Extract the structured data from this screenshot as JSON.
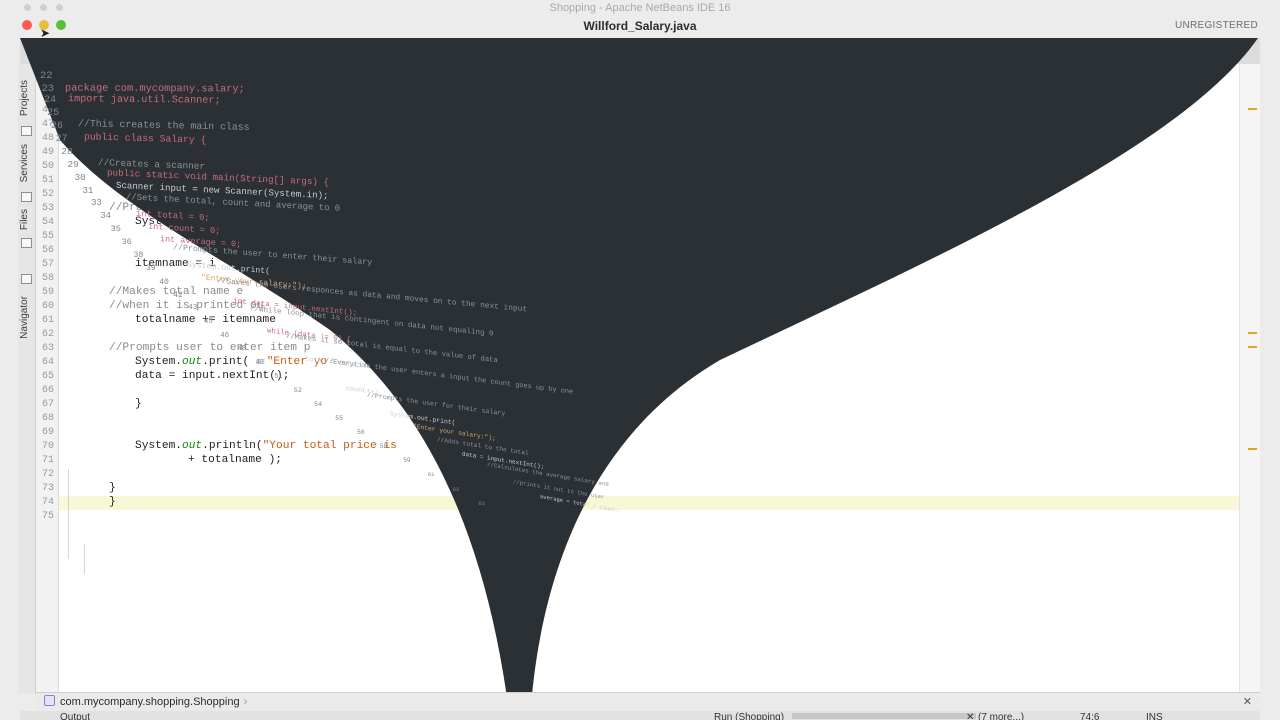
{
  "window": {
    "app_title": "Shopping - Apache NetBeans IDE 16",
    "file_title": "Willford_Salary.java",
    "registration": "UNREGISTERED"
  },
  "tabs": [
    {
      "label": "Willford_Salary.java",
      "active": true
    }
  ],
  "sidebar": {
    "items": [
      "Projects",
      "Services",
      "Files",
      "Navigator"
    ]
  },
  "editor": {
    "lines": [
      {
        "num": "44"
      },
      {
        "num": "45"
      },
      {
        "num": "46"
      },
      {
        "num": "47"
      },
      {
        "num": "48"
      },
      {
        "num": "49"
      },
      {
        "num": "50"
      },
      {
        "num": "51"
      },
      {
        "num": "52"
      },
      {
        "num": "53",
        "comment": "//Promp"
      },
      {
        "num": "54",
        "code": "System"
      },
      {
        "num": "55"
      },
      {
        "num": "56"
      },
      {
        "num": "57",
        "code": "itemname = i"
      },
      {
        "num": "58"
      },
      {
        "num": "59",
        "comment": "//Makes total name e"
      },
      {
        "num": "60",
        "comment": "//when it is printed ou"
      },
      {
        "num": "61",
        "code": "totalname += itemname"
      },
      {
        "num": "62"
      },
      {
        "num": "63",
        "comment": "//Prompts user to enter item p"
      },
      {
        "num": "64",
        "pre": "System.",
        "field": "out",
        "mid": ".print( ",
        "hint": "s:",
        "string": "\"Enter yo"
      },
      {
        "num": "65",
        "code": "data = input.nextInt();"
      },
      {
        "num": "66"
      },
      {
        "num": "67",
        "code": "}"
      },
      {
        "num": "68"
      },
      {
        "num": "69"
      },
      {
        "num": "70",
        "pre": "System.",
        "field": "out",
        "mid": ".println(",
        "string": "\"Your total price is"
      },
      {
        "num": "71",
        "code": "+ totalname );"
      },
      {
        "num": "72"
      },
      {
        "num": "73",
        "code": "}"
      },
      {
        "num": "74",
        "code": "}",
        "highlight": true
      },
      {
        "num": "75"
      }
    ]
  },
  "ghost_code": {
    "lines": [
      {
        "num": "22",
        "text": ""
      },
      {
        "num": "23",
        "text": "package com.mycompany.salary;"
      },
      {
        "num": "24",
        "text": "import java.util.Scanner;"
      },
      {
        "num": "25",
        "text": ""
      },
      {
        "num": "26",
        "text": "//This creates the main class"
      },
      {
        "num": "27",
        "text": "public class Salary {"
      },
      {
        "num": "28",
        "text": ""
      },
      {
        "num": "29",
        "text": "//Creates a scanner"
      },
      {
        "num": "30",
        "text": "public static void main(String[] args) {"
      },
      {
        "num": "31",
        "text": "Scanner input = new Scanner(System.in);"
      },
      {
        "num": "33",
        "text": "//Sets the total, count and average to 0"
      },
      {
        "num": "34",
        "text": "int total = 0;"
      },
      {
        "num": "35",
        "text": "int count = 0;"
      },
      {
        "num": "36",
        "text": "int average = 0;"
      },
      {
        "num": "38",
        "text": "//Prompts the user to enter their salary"
      },
      {
        "num": "39",
        "text": "System.out.print("
      },
      {
        "num": "40",
        "text": "\"Enter your salary:\");"
      },
      {
        "num": "42",
        "text": "//Saves the users responces as data and moves on to the next input"
      },
      {
        "num": "43",
        "text": "int data = input.nextInt();"
      },
      {
        "num": "45",
        "text": "//While loop that is contingent on data not equaling 0"
      },
      {
        "num": "46",
        "text": "while (data != 0) {"
      },
      {
        "num": "48",
        "text": "//Makes it so total is equal to the value of data"
      },
      {
        "num": "49",
        "text": "total = data;"
      },
      {
        "num": "51",
        "text": "//Everytime the user enters a input the count goes up by one"
      },
      {
        "num": "52",
        "text": "count++;"
      },
      {
        "num": "54",
        "text": "//Prompts the user for their salary"
      },
      {
        "num": "55",
        "text": "System.out.print("
      },
      {
        "num": "56",
        "text": "\"Enter your salary:\");"
      },
      {
        "num": "58",
        "text": "//Adds total to the total"
      },
      {
        "num": "59",
        "text": "data = input.nextInt();"
      },
      {
        "num": "61",
        "text": "//Calculates the average salary and"
      },
      {
        "num": "62",
        "text": "//prints it out to the user"
      },
      {
        "num": "63",
        "text": "average = total / count;"
      }
    ]
  },
  "status": {
    "breadcrumb": "com.mycompany.shopping.Shopping",
    "output_tab": "Output",
    "run_label": "Run (Shopping)",
    "more_label": "(7 more...)",
    "position": "74:6",
    "mode": "INS"
  },
  "colors": {
    "curl": "#2b3035",
    "accent_warning": "#e3a320",
    "line_highlight": "#f8f7d6"
  }
}
